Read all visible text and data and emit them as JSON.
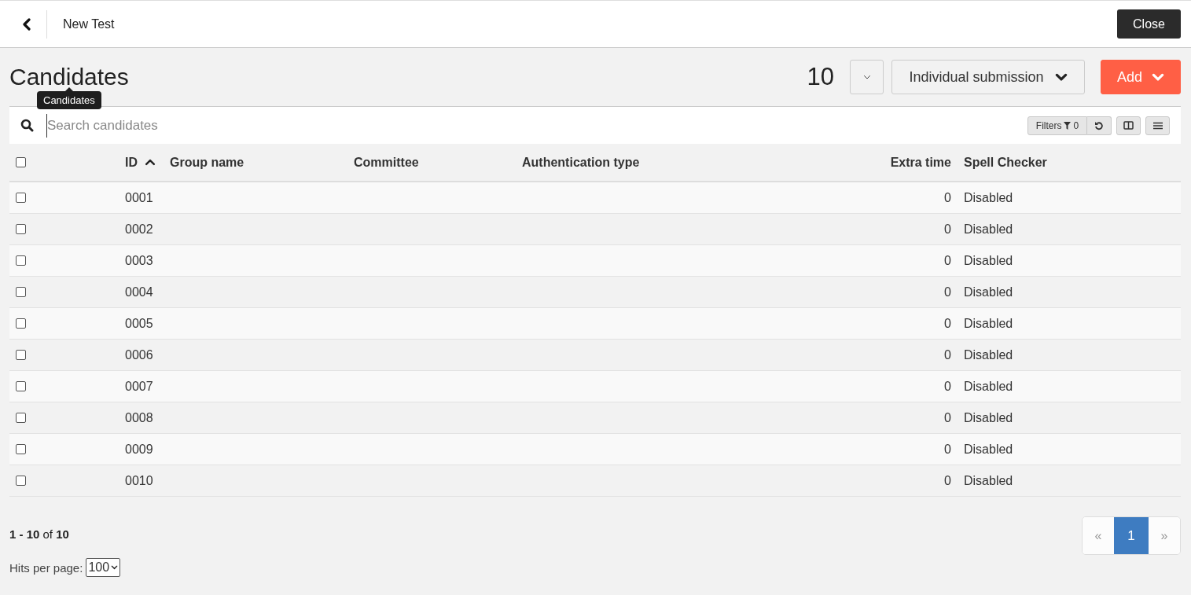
{
  "header": {
    "title": "New Test",
    "close_button": "Close"
  },
  "page_title": "Candidates",
  "tooltip": "Candidates",
  "count": "10",
  "submission_dropdown": "Individual submission",
  "add_button": "Add",
  "search": {
    "placeholder": "Search candidates"
  },
  "filters": {
    "label": "Filters",
    "count": "0"
  },
  "table": {
    "select_all_checked": false,
    "columns": [
      {
        "label": "ID",
        "sorted": true
      },
      {
        "label": "Group name",
        "sorted": false
      },
      {
        "label": "Committee",
        "sorted": false
      },
      {
        "label": "Authentication type",
        "sorted": false
      },
      {
        "label": "Extra time",
        "sorted": false
      },
      {
        "label": "Spell Checker",
        "sorted": false
      }
    ],
    "rows": [
      {
        "checked": false,
        "id": "0001",
        "extra_time": "0",
        "spell_checker": "Disabled"
      },
      {
        "checked": false,
        "id": "0002",
        "extra_time": "0",
        "spell_checker": "Disabled"
      },
      {
        "checked": false,
        "id": "0003",
        "extra_time": "0",
        "spell_checker": "Disabled"
      },
      {
        "checked": false,
        "id": "0004",
        "extra_time": "0",
        "spell_checker": "Disabled"
      },
      {
        "checked": false,
        "id": "0005",
        "extra_time": "0",
        "spell_checker": "Disabled"
      },
      {
        "checked": false,
        "id": "0006",
        "extra_time": "0",
        "spell_checker": "Disabled"
      },
      {
        "checked": false,
        "id": "0007",
        "extra_time": "0",
        "spell_checker": "Disabled"
      },
      {
        "checked": false,
        "id": "0008",
        "extra_time": "0",
        "spell_checker": "Disabled"
      },
      {
        "checked": false,
        "id": "0009",
        "extra_time": "0",
        "spell_checker": "Disabled"
      },
      {
        "checked": false,
        "id": "0010",
        "extra_time": "0",
        "spell_checker": "Disabled"
      }
    ]
  },
  "summary": "**1 - 10** of **10**",
  "hits_per_page": {
    "label": "Hits per page:",
    "value": "100"
  },
  "pagination": {
    "previous": "«",
    "pages": [
      {
        "label": "1",
        "selected": true
      }
    ],
    "next": "»"
  }
}
